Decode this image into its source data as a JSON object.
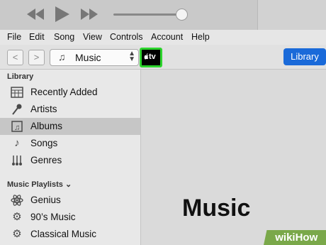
{
  "menu": [
    "File",
    "Edit",
    "Song",
    "View",
    "Controls",
    "Account",
    "Help"
  ],
  "toolbar": {
    "back": "<",
    "forward": ">",
    "media_selector": "Music",
    "tv_label": "tv",
    "library_button": "Library"
  },
  "sidebar": {
    "library_header": "Library",
    "library_items": [
      "Recently Added",
      "Artists",
      "Albums",
      "Songs",
      "Genres"
    ],
    "selected": "Albums",
    "playlists_header": "Music Playlists",
    "playlist_items": [
      "Genius",
      "90’s Music",
      "Classical Music"
    ]
  },
  "main": {
    "title": "Music"
  },
  "watermark": "wikiHow",
  "colors": {
    "highlight": "#2cd42c",
    "accent": "#1a6ad9"
  },
  "volume_level": 0.92
}
